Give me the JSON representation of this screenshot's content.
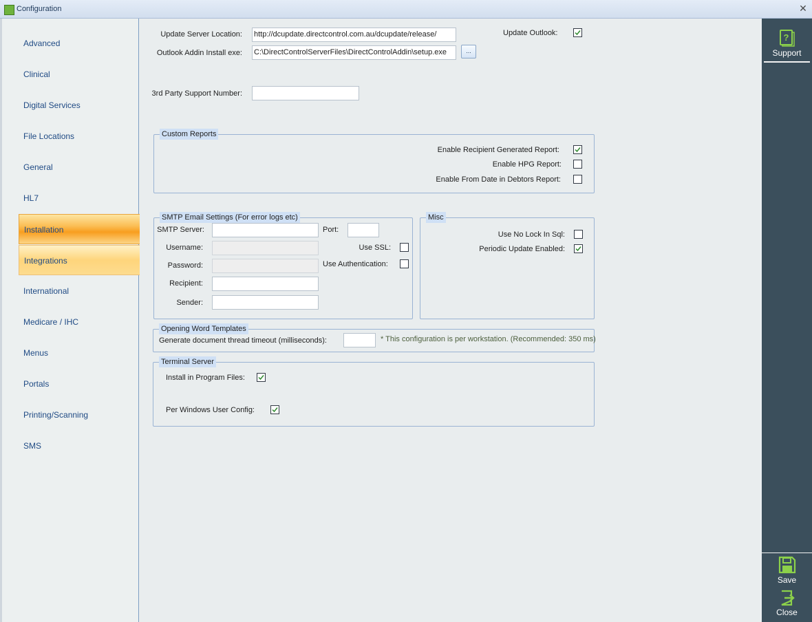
{
  "window": {
    "title": "Configuration",
    "close_glyph": "✕"
  },
  "nav": {
    "items": [
      {
        "label": "Advanced",
        "state": "normal"
      },
      {
        "label": "Clinical",
        "state": "normal"
      },
      {
        "label": "Digital Services",
        "state": "normal"
      },
      {
        "label": "File Locations",
        "state": "normal"
      },
      {
        "label": "General",
        "state": "normal"
      },
      {
        "label": "HL7",
        "state": "normal"
      },
      {
        "label": "Installation",
        "state": "selected"
      },
      {
        "label": "Integrations",
        "state": "hover"
      },
      {
        "label": "International",
        "state": "normal"
      },
      {
        "label": "Medicare / IHC",
        "state": "normal"
      },
      {
        "label": "Menus",
        "state": "normal"
      },
      {
        "label": "Portals",
        "state": "normal"
      },
      {
        "label": "Printing/Scanning",
        "state": "normal"
      },
      {
        "label": "SMS",
        "state": "normal"
      }
    ]
  },
  "actions": {
    "support_label": "Support",
    "save_label": "Save",
    "close_label": "Close",
    "icon_color": "#8cd14a"
  },
  "installation": {
    "update_server_label": "Update Server Location:",
    "update_server_value": "http://dcupdate.directcontrol.com.au/dcupdate/release/",
    "outlook_addin_label": "Outlook Addin Install exe:",
    "outlook_addin_value": "C:\\DirectControlServerFiles\\DirectControlAddin\\setup.exe",
    "browse_label": "...",
    "update_outlook_label": "Update Outlook:",
    "update_outlook_checked": true,
    "third_party_label": "3rd Party Support Number:",
    "third_party_value": ""
  },
  "custom_reports": {
    "title": "Custom Reports",
    "options": [
      {
        "label": "Enable Recipient Generated Report:",
        "checked": true
      },
      {
        "label": "Enable HPG Report:",
        "checked": false
      },
      {
        "label": "Enable From Date in Debtors Report:",
        "checked": false
      }
    ]
  },
  "smtp": {
    "title": "SMTP Email Settings (For error logs etc)",
    "server_label": "SMTP Server:",
    "server_value": "",
    "port_label": "Port:",
    "port_value": "",
    "username_label": "Username:",
    "password_label": "Password:",
    "recipient_label": "Recipient:",
    "sender_label": "Sender:",
    "use_ssl_label": "Use SSL:",
    "use_ssl_checked": false,
    "use_auth_label": "Use Authentication:",
    "use_auth_checked": false
  },
  "misc": {
    "title": "Misc",
    "options": [
      {
        "label": "Use No Lock In Sql:",
        "checked": false
      },
      {
        "label": "Periodic Update Enabled:",
        "checked": true
      }
    ]
  },
  "word_templates": {
    "title": "Opening Word Templates",
    "timeout_label": "Generate document thread timeout (milliseconds):",
    "timeout_value": "",
    "note": "* This configuration is per workstation. (Recommended: 350 ms)"
  },
  "terminal_server": {
    "title": "Terminal Server",
    "install_program_files_label": "Install in Program Files:",
    "install_program_files_checked": true,
    "per_user_config_label": "Per Windows User Config:",
    "per_user_config_checked": true
  },
  "colors": {
    "accent_selected": "#f89e1f",
    "nav_text": "#1f4a84",
    "actionbar_bg": "#3b4f5c",
    "check_green": "#2f8a2f"
  }
}
